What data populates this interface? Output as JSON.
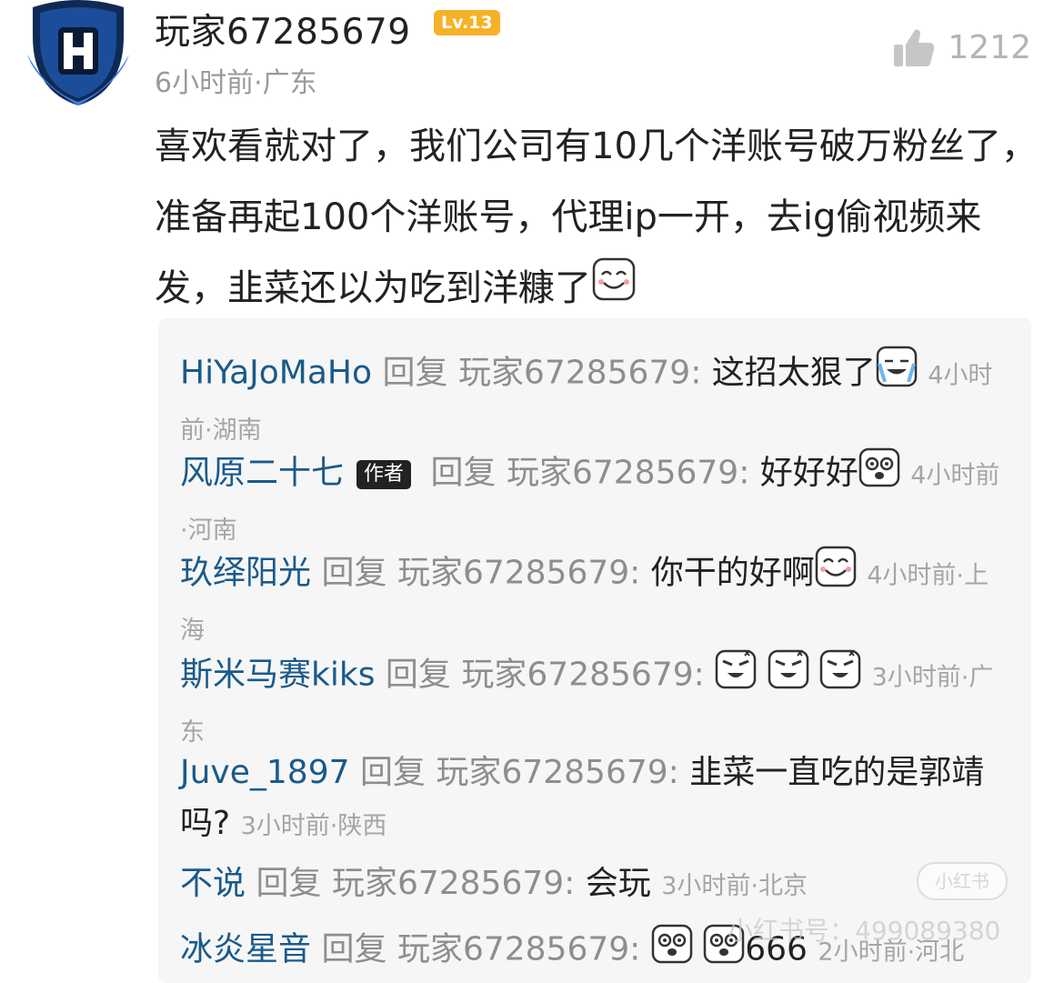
{
  "comment": {
    "username": "玩家67285679",
    "level": "Lv.13",
    "time": "6小时前",
    "location": "广东",
    "like_count": "1212",
    "text": "喜欢看就对了，我们公司有10几个洋账号破万粉丝了，准备再起100个洋账号，代理ip一开，去ig偷视频来发，韭菜还以为吃到洋糠了"
  },
  "reply_verb": "回复",
  "reply_target": "玩家67285679:",
  "author_tag": "作者",
  "replies": [
    {
      "name": "HiYaJoMaHo",
      "text": "这招太狠了",
      "time": "4小时前",
      "location": "湖南"
    },
    {
      "name": "风原二十七",
      "text": "好好好",
      "time": "4小时前",
      "location": "河南"
    },
    {
      "name": "玖绎阳光",
      "text": "你干的好啊",
      "time": "4小时前",
      "location": "上海"
    },
    {
      "name": "斯米马赛kiks",
      "text": "",
      "time": "3小时前",
      "location": "广东"
    },
    {
      "name": "Juve_1897",
      "text": "韭菜一直吃的是郭靖吗?",
      "time": "3小时前",
      "location": "陕西"
    },
    {
      "name": "不说",
      "text": "会玩",
      "time": "3小时前",
      "location": "北京"
    },
    {
      "name": "冰炎星音",
      "text": "666",
      "time": "2小时前",
      "location": "河北"
    }
  ],
  "watermark": {
    "logo": "小红书",
    "id": "小红书号：499089380"
  }
}
